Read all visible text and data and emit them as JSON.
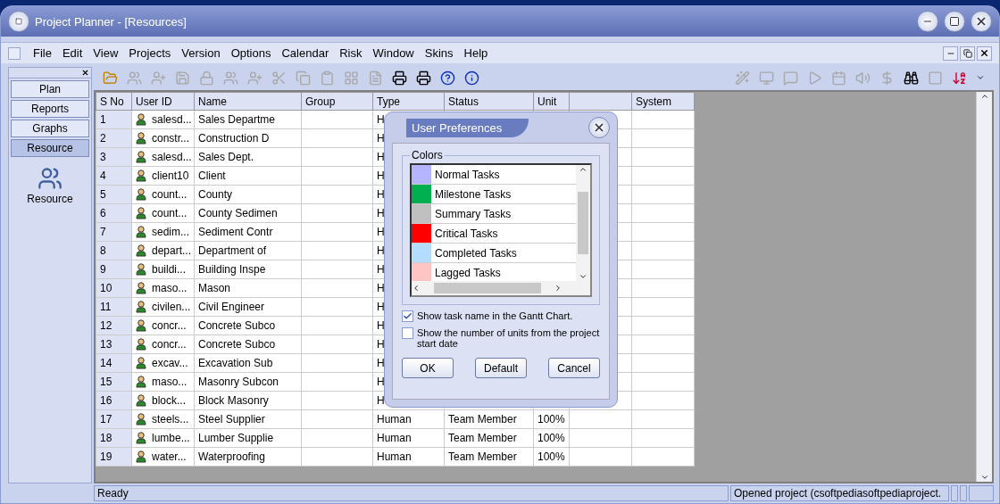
{
  "window": {
    "title": "Project Planner - [Resources]"
  },
  "menu": [
    "File",
    "Edit",
    "View",
    "Projects",
    "Version",
    "Options",
    "Calendar",
    "Risk",
    "Window",
    "Skins",
    "Help"
  ],
  "toolbar": {
    "left": [
      {
        "kind": "open",
        "disabled": false
      },
      {
        "kind": "people",
        "disabled": true
      },
      {
        "kind": "user-add",
        "disabled": true
      },
      {
        "kind": "save",
        "disabled": true
      },
      {
        "kind": "lock",
        "disabled": true
      },
      {
        "kind": "people",
        "disabled": true
      },
      {
        "kind": "user-add",
        "disabled": true
      },
      {
        "kind": "cut",
        "disabled": true
      },
      {
        "kind": "copy",
        "disabled": true
      },
      {
        "kind": "paste",
        "disabled": true
      },
      {
        "kind": "grid",
        "disabled": true
      },
      {
        "kind": "document",
        "disabled": true
      },
      {
        "kind": "print",
        "disabled": false
      },
      {
        "kind": "print-preview",
        "disabled": false
      },
      {
        "kind": "help",
        "disabled": false
      },
      {
        "kind": "info",
        "disabled": false
      }
    ],
    "right": [
      {
        "kind": "wand",
        "disabled": true
      },
      {
        "kind": "monitor",
        "disabled": true
      },
      {
        "kind": "comment",
        "disabled": true
      },
      {
        "kind": "play",
        "disabled": true
      },
      {
        "kind": "calendar",
        "disabled": true
      },
      {
        "kind": "sound",
        "disabled": true
      },
      {
        "kind": "dollar",
        "disabled": true
      },
      {
        "kind": "binoculars",
        "disabled": false
      },
      {
        "kind": "square",
        "disabled": true
      },
      {
        "kind": "sort",
        "disabled": false
      }
    ]
  },
  "sidebar": {
    "items": [
      {
        "label": "Plan",
        "selected": false
      },
      {
        "label": "Reports",
        "selected": false
      },
      {
        "label": "Graphs",
        "selected": false
      },
      {
        "label": "Resource",
        "selected": true
      }
    ],
    "icon_label": "Resource"
  },
  "table": {
    "columns": [
      "S No",
      "User ID",
      "Name",
      "Group",
      "Type",
      "Status",
      "Unit",
      "",
      "System"
    ],
    "rows": [
      {
        "s_no": "1",
        "user_id": "salesd...",
        "name": "Sales Departme",
        "type": "H"
      },
      {
        "s_no": "2",
        "user_id": "constr...",
        "name": "Construction D",
        "type": "H"
      },
      {
        "s_no": "3",
        "user_id": "salesd...",
        "name": "Sales Dept.",
        "type": "H"
      },
      {
        "s_no": "4",
        "user_id": "client10",
        "name": "Client",
        "type": "H"
      },
      {
        "s_no": "5",
        "user_id": "count...",
        "name": "County",
        "type": "H"
      },
      {
        "s_no": "6",
        "user_id": "count...",
        "name": "County Sedimen",
        "type": "H"
      },
      {
        "s_no": "7",
        "user_id": "sedim...",
        "name": "Sediment Contr",
        "type": "H"
      },
      {
        "s_no": "8",
        "user_id": "depart...",
        "name": "Department of",
        "type": "H"
      },
      {
        "s_no": "9",
        "user_id": "buildi...",
        "name": "Building Inspe",
        "type": "H"
      },
      {
        "s_no": "10",
        "user_id": "maso...",
        "name": "Mason",
        "type": "H"
      },
      {
        "s_no": "11",
        "user_id": "civilen...",
        "name": "Civil Engineer",
        "type": "H"
      },
      {
        "s_no": "12",
        "user_id": "concr...",
        "name": "Concrete Subco",
        "type": "H"
      },
      {
        "s_no": "13",
        "user_id": "concr...",
        "name": "Concrete Subco",
        "type": "H"
      },
      {
        "s_no": "14",
        "user_id": "excav...",
        "name": "Excavation Sub",
        "type": "H"
      },
      {
        "s_no": "15",
        "user_id": "maso...",
        "name": "Masonry Subcon",
        "type": "H"
      },
      {
        "s_no": "16",
        "user_id": "block...",
        "name": "Block Masonry",
        "type": "H"
      },
      {
        "s_no": "17",
        "user_id": "steels...",
        "name": "Steel Supplier",
        "type": "Human",
        "status": "Team Member",
        "unit": "100%"
      },
      {
        "s_no": "18",
        "user_id": "lumbe...",
        "name": "Lumber Supplie",
        "type": "Human",
        "status": "Team Member",
        "unit": "100%"
      },
      {
        "s_no": "19",
        "user_id": "water...",
        "name": "Waterproofing",
        "type": "Human",
        "status": "Team Member",
        "unit": "100%"
      }
    ]
  },
  "dialog": {
    "title": "User Preferences",
    "group_label": "Colors",
    "colors": [
      {
        "label": "Normal Tasks",
        "color": "#b4b4ff"
      },
      {
        "label": "Milestone Tasks",
        "color": "#00b050"
      },
      {
        "label": "Summary Tasks",
        "color": "#c0c0c0"
      },
      {
        "label": "Critical Tasks",
        "color": "#ff0000"
      },
      {
        "label": "Completed Tasks",
        "color": "#b4dcff"
      },
      {
        "label": "Lagged Tasks",
        "color": "#ffc4c4"
      }
    ],
    "options": [
      {
        "label": "Show task name in the Gantt Chart.",
        "checked": true
      },
      {
        "label": "Show the number of units from the project start date",
        "checked": false
      }
    ],
    "buttons": [
      "OK",
      "Default",
      "Cancel"
    ]
  },
  "status_bar": {
    "left": "Ready",
    "right": "Opened project (csoftpediasoftpediaproject."
  }
}
